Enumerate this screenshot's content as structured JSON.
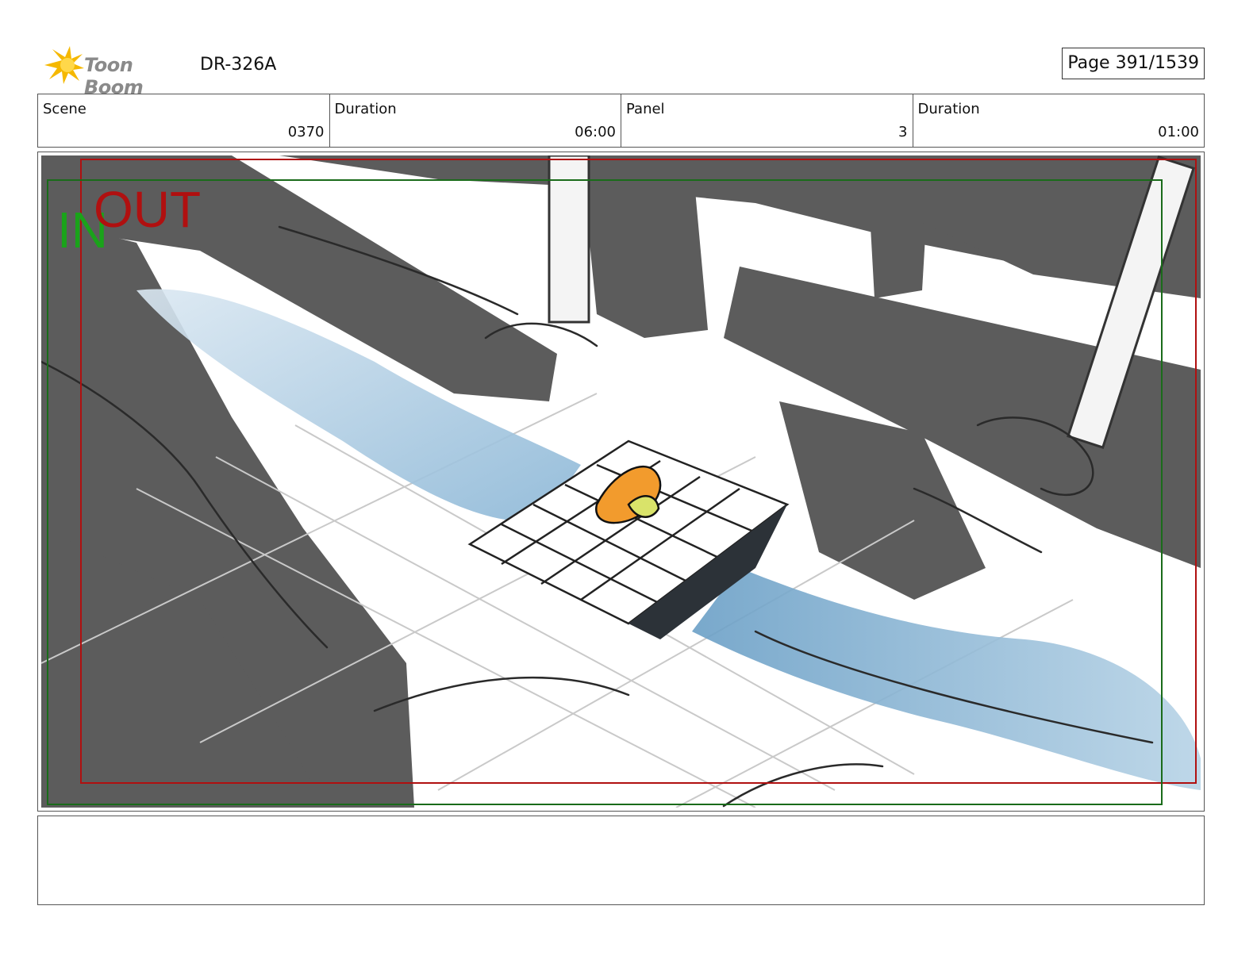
{
  "header": {
    "logo_text": "Toon Boom",
    "doc_id": "DR-326A",
    "page_label": "Page",
    "page_value": "391/1539"
  },
  "info": {
    "scene_label": "Scene",
    "scene_value": "0370",
    "scene_duration_label": "Duration",
    "scene_duration_value": "06:00",
    "panel_label": "Panel",
    "panel_value": "3",
    "panel_duration_label": "Duration",
    "panel_duration_value": "01:00"
  },
  "panel": {
    "in_marker": "IN",
    "out_marker": "OUT",
    "in_color": "#1aa31a",
    "out_color": "#b01010",
    "shadow_color": "#5c5c5c",
    "water_color": "#7fb0d3"
  },
  "notes": {
    "text": ""
  }
}
